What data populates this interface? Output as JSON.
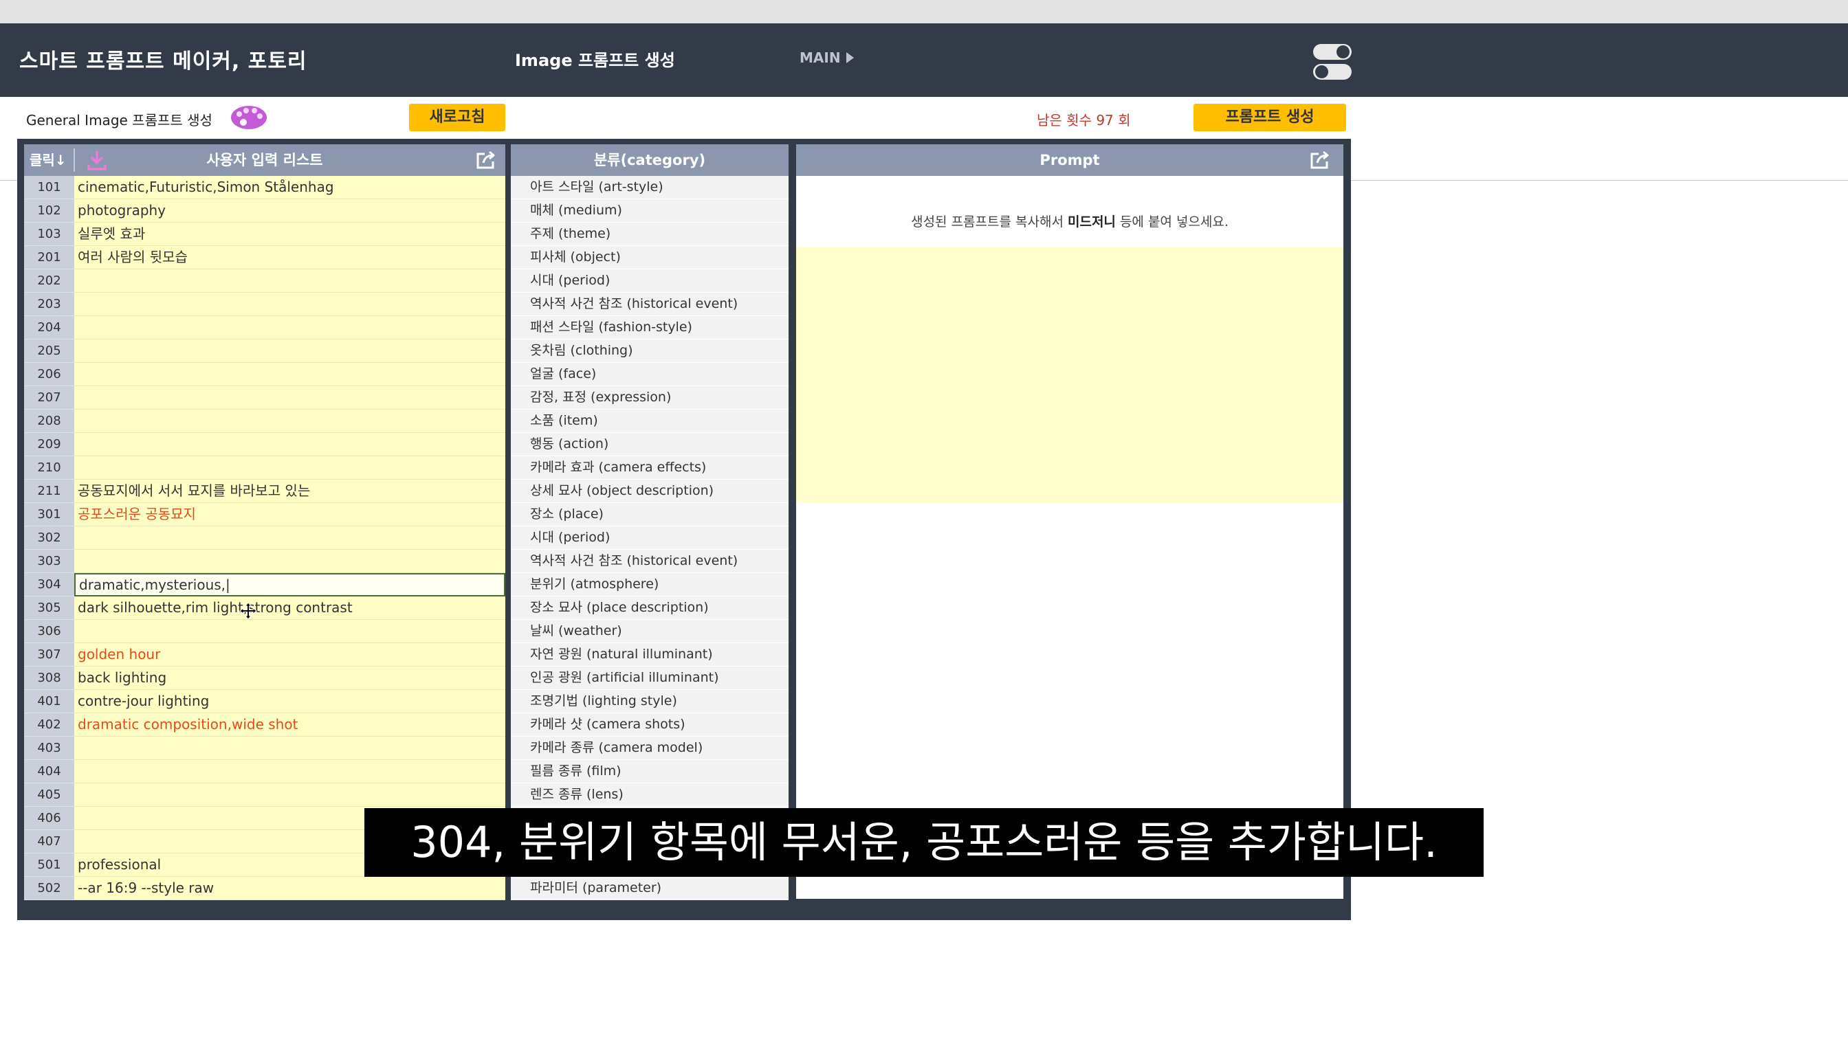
{
  "header": {
    "app_title": "스마트 프롬프트 메이커, 포토리",
    "page_title": "Image 프롬프트 생성",
    "main_link": "MAIN"
  },
  "subbar": {
    "title": "General Image 프롬프트 생성",
    "refresh_label": "새로고침",
    "remaining_label": "남은 횟수 97 회",
    "generate_label": "프롬프트 생성"
  },
  "colors": {
    "topbar": "#333b48",
    "panel_header": "#8a97ae",
    "button": "#ffbf00",
    "input_bg": "#fffec4",
    "red_text": "#e34a1c"
  },
  "icons": {
    "download": "download-icon",
    "export": "export-icon",
    "palette": "palette-icon",
    "toggle": "toggle-icon"
  },
  "left_panel": {
    "click_sort": "클릭↓",
    "title": "사용자 입력 리스트",
    "rows": [
      {
        "num": "101",
        "value": "cinematic,Futuristic,Simon Stålenhag",
        "red": false
      },
      {
        "num": "102",
        "value": "photography",
        "red": false
      },
      {
        "num": "103",
        "value": "실루엣 효과",
        "red": false
      },
      {
        "num": "201",
        "value": "여러 사람의 뒷모습",
        "red": false
      },
      {
        "num": "202",
        "value": "",
        "red": false
      },
      {
        "num": "203",
        "value": "",
        "red": false
      },
      {
        "num": "204",
        "value": "",
        "red": false
      },
      {
        "num": "205",
        "value": "",
        "red": false
      },
      {
        "num": "206",
        "value": "",
        "red": false
      },
      {
        "num": "207",
        "value": "",
        "red": false
      },
      {
        "num": "208",
        "value": "",
        "red": false
      },
      {
        "num": "209",
        "value": "",
        "red": false
      },
      {
        "num": "210",
        "value": "",
        "red": false
      },
      {
        "num": "211",
        "value": "공동묘지에서 서서 묘지를 바라보고 있는",
        "red": false
      },
      {
        "num": "301",
        "value": "공포스러운 공동묘지",
        "red": true
      },
      {
        "num": "302",
        "value": "",
        "red": false
      },
      {
        "num": "303",
        "value": "",
        "red": false
      },
      {
        "num": "304",
        "value": "dramatic,mysterious,|",
        "red": false,
        "active": true
      },
      {
        "num": "305",
        "value": "dark silhouette,rim light,strong contrast",
        "red": false
      },
      {
        "num": "306",
        "value": "",
        "red": false
      },
      {
        "num": "307",
        "value": "golden hour",
        "red": true
      },
      {
        "num": "308",
        "value": "back lighting",
        "red": false
      },
      {
        "num": "401",
        "value": "contre-jour lighting",
        "red": false
      },
      {
        "num": "402",
        "value": "dramatic composition,wide shot",
        "red": true
      },
      {
        "num": "403",
        "value": "",
        "red": false
      },
      {
        "num": "404",
        "value": "",
        "red": false
      },
      {
        "num": "405",
        "value": "",
        "red": false
      },
      {
        "num": "406",
        "value": "",
        "red": false
      },
      {
        "num": "407",
        "value": "",
        "red": false
      },
      {
        "num": "501",
        "value": "professional",
        "red": false
      },
      {
        "num": "502",
        "value": "--ar 16:9 --style raw",
        "red": false
      }
    ]
  },
  "mid_panel": {
    "title": "분류(category)",
    "rows": [
      "아트 스타일 (art-style)",
      "매체 (medium)",
      "주제 (theme)",
      "피사체 (object)",
      "시대 (period)",
      "역사적 사건 참조 (historical event)",
      "패션 스타일 (fashion-style)",
      "옷차림 (clothing)",
      "얼굴 (face)",
      "감정, 표정 (expression)",
      "소품 (item)",
      "행동 (action)",
      "카메라 효과 (camera effects)",
      "상세 묘사 (object description)",
      "장소 (place)",
      "시대 (period)",
      "역사적 사건 참조 (historical event)",
      "분위기 (atmosphere)",
      "장소 묘사 (place description)",
      "날씨 (weather)",
      "자연 광원 (natural illuminant)",
      "인공 광원 (artificial illuminant)",
      "조명기법 (lighting style)",
      "카메라 샷 (camera shots)",
      "카메라 종류 (camera model)",
      "필름 종류 (film)",
      "렌즈 종류 (lens)",
      "",
      "",
      "",
      "파라미터 (parameter)"
    ]
  },
  "right_panel": {
    "title": "Prompt",
    "hint_prefix": "생성된 프롬프트를 복사해서 ",
    "hint_bold": "미드저니",
    "hint_suffix": " 등에 붙여 넣으세요."
  },
  "subtitle": "304, 분위기 항목에 무서운, 공포스러운 등을 추가합니다."
}
